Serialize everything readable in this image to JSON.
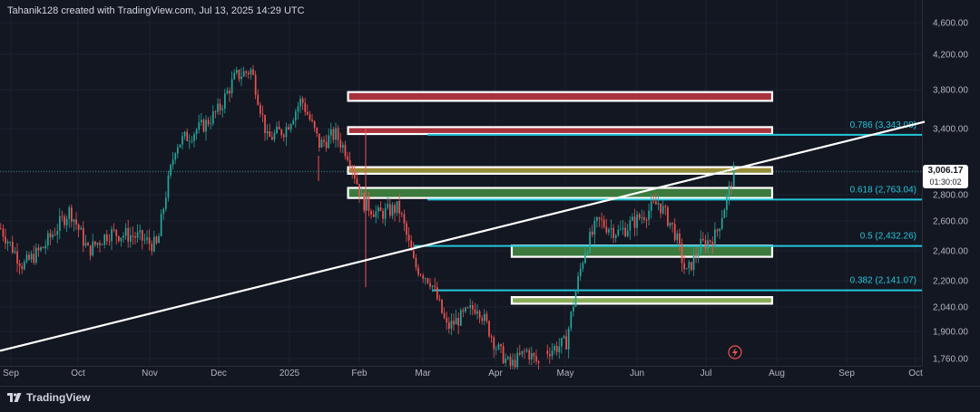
{
  "header": {
    "attribution": "Tahanik128 created with TradingView.com, Jul 13, 2025 14:29 UTC"
  },
  "footer": {
    "brand_label": "TradingView"
  },
  "last_price": {
    "value": "3,006.17",
    "countdown": "01:30:02"
  },
  "colors": {
    "background": "#131722",
    "grid": "#1e222d",
    "up": "#26a69a",
    "down": "#ef5350",
    "fib": "#26c6da",
    "trend": "#ffffff",
    "zone_red": "#a8323d",
    "zone_yellow": "#9b8b32",
    "zone_green": "#3c7a3e",
    "zone_green_light": "#8aab5a"
  },
  "chart_data": {
    "type": "candlestick",
    "title": "",
    "xlabel": "",
    "ylabel": "",
    "ylim": [
      1700,
      4650
    ],
    "grid": true,
    "y_ticks": [
      "4,600.00",
      "4,200.00",
      "3,800.00",
      "3,400.00",
      "3,000.00",
      "2,800.00",
      "2,600.00",
      "2,400.00",
      "2,200.00",
      "2,040.00",
      "1,900.00",
      "1,760.00"
    ],
    "y_tick_values": [
      4600,
      4200,
      3800,
      3400,
      3000,
      2800,
      2600,
      2400,
      2200,
      2040,
      1900,
      1760
    ],
    "x_ticks": [
      "Sep",
      "Oct",
      "Nov",
      "Dec",
      "2025",
      "Feb",
      "Mar",
      "Apr",
      "May",
      "Jun",
      "Jul",
      "Aug",
      "Sep",
      "Oct"
    ],
    "x_tick_dates": [
      "2024-09-01",
      "2024-10-01",
      "2024-11-01",
      "2024-12-01",
      "2025-01-01",
      "2025-02-01",
      "2025-03-01",
      "2025-04-01",
      "2025-05-01",
      "2025-06-01",
      "2025-07-01",
      "2025-08-01",
      "2025-09-01",
      "2025-10-01"
    ],
    "price_path": [
      [
        "2024-08-27",
        2550
      ],
      [
        "2024-09-06",
        2300
      ],
      [
        "2024-09-15",
        2420
      ],
      [
        "2024-09-27",
        2680
      ],
      [
        "2024-10-05",
        2400
      ],
      [
        "2024-10-14",
        2520
      ],
      [
        "2024-10-25",
        2500
      ],
      [
        "2024-11-04",
        2430
      ],
      [
        "2024-11-12",
        3250
      ],
      [
        "2024-11-25",
        3450
      ],
      [
        "2024-12-01",
        3600
      ],
      [
        "2024-12-08",
        3950
      ],
      [
        "2024-12-15",
        4020
      ],
      [
        "2024-12-22",
        3300
      ],
      [
        "2024-12-30",
        3400
      ],
      [
        "2025-01-06",
        3700
      ],
      [
        "2025-01-14",
        3250
      ],
      [
        "2025-01-21",
        3350
      ],
      [
        "2025-01-27",
        3150
      ],
      [
        "2025-02-02",
        2750
      ],
      [
        "2025-02-09",
        2650
      ],
      [
        "2025-02-18",
        2700
      ],
      [
        "2025-02-25",
        2300
      ],
      [
        "2025-03-04",
        2200
      ],
      [
        "2025-03-11",
        1920
      ],
      [
        "2025-03-24",
        2050
      ],
      [
        "2025-04-01",
        1820
      ],
      [
        "2025-04-07",
        1720
      ],
      [
        "2025-04-14",
        1800
      ],
      [
        "2025-04-20",
        1720
      ]
    ],
    "price_path_2": [
      [
        "2025-04-23",
        1800
      ],
      [
        "2025-05-01",
        1840
      ],
      [
        "2025-05-09",
        2400
      ],
      [
        "2025-05-15",
        2600
      ],
      [
        "2025-05-24",
        2520
      ],
      [
        "2025-06-03",
        2640
      ],
      [
        "2025-06-10",
        2740
      ],
      [
        "2025-06-17",
        2530
      ],
      [
        "2025-06-22",
        2240
      ],
      [
        "2025-06-28",
        2430
      ],
      [
        "2025-07-05",
        2500
      ],
      [
        "2025-07-10",
        2780
      ],
      [
        "2025-07-13",
        3006
      ]
    ],
    "zones": [
      {
        "from": "2025-01-27",
        "to": "2025-07-30",
        "low": 3685,
        "high": 3775,
        "color": "red"
      },
      {
        "from": "2025-01-27",
        "to": "2025-07-30",
        "low": 3350,
        "high": 3415,
        "color": "red"
      },
      {
        "from": "2025-01-27",
        "to": "2025-07-30",
        "low": 2985,
        "high": 3045,
        "color": "yellow"
      },
      {
        "from": "2025-01-27",
        "to": "2025-07-30",
        "low": 2775,
        "high": 2860,
        "color": "green"
      },
      {
        "from": "2025-04-08",
        "to": "2025-07-30",
        "low": 2360,
        "high": 2435,
        "color": "green"
      },
      {
        "from": "2025-04-08",
        "to": "2025-07-30",
        "low": 2060,
        "high": 2100,
        "color": "green_light"
      }
    ],
    "fib_levels": [
      {
        "label": "0.786 (3,343.08)",
        "value": 3343.08,
        "from": "2025-03-03"
      },
      {
        "label": "0.618 (2,763.04)",
        "value": 2763.04,
        "from": "2025-03-03"
      },
      {
        "label": "0.5 (2,432.26)",
        "value": 2432.26,
        "from": "2025-02-25"
      },
      {
        "label": "0.382 (2,141.07)",
        "value": 2141.07,
        "from": "2025-03-05"
      }
    ],
    "trend_line": {
      "start": [
        "2024-08-27",
        1800
      ],
      "end": [
        "2025-10-05",
        3470
      ]
    }
  }
}
